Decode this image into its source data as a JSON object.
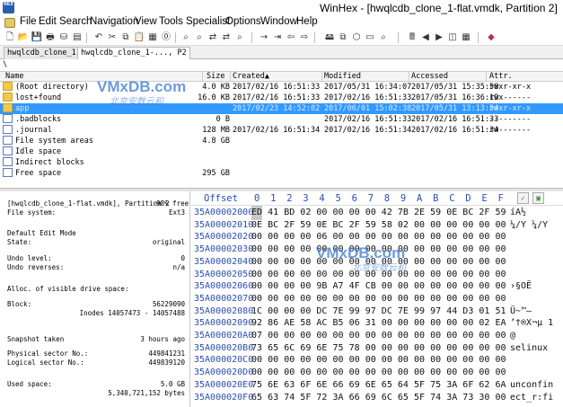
{
  "window": {
    "title": "WinHex - [hwqlcdb_clone_1-flat.vmdk, Partition 2]"
  },
  "menu": [
    "File",
    "Edit",
    "Search",
    "Navigation",
    "View",
    "Tools",
    "Specialist",
    "Options",
    "Window",
    "Help"
  ],
  "tabs": [
    {
      "label": "hwqlcdb_clone_1-...",
      "active": false
    },
    {
      "label": "hwqlcdb_clone_1-..., P2",
      "active": true
    }
  ],
  "path": "\\",
  "filelist": {
    "columns": [
      "Name",
      "Size",
      "Created▲",
      "Modified",
      "Accessed",
      "Attr."
    ],
    "rows": [
      {
        "name": "(Root directory)",
        "size": "4.0 KB",
        "created": "2017/02/16  16:51:33",
        "modified": "2017/05/31  16:34:07",
        "accessed": "2017/05/31  15:35:58",
        "attr": "rwxr-xr-x",
        "icon": "folder",
        "selected": false
      },
      {
        "name": "lost+found",
        "size": "16.0 KB",
        "created": "2017/02/16  16:51:33",
        "modified": "2017/02/16  16:51:33",
        "accessed": "2017/05/31  16:36:19",
        "attr": "rwx------",
        "icon": "folder",
        "selected": false
      },
      {
        "name": "app",
        "size": "",
        "created": "2017/02/23  14:52:02",
        "modified": "2017/06/01  15:02:38",
        "accessed": "2017/05/31  13:13:54",
        "attr": "rwxr-xr-x",
        "icon": "folder",
        "selected": true
      },
      {
        "name": ".badblocks",
        "size": "0 B",
        "created": "",
        "modified": "2017/02/16  16:51:33",
        "accessed": "2017/02/16  16:51:33",
        "attr": "---------",
        "icon": "file",
        "selected": false
      },
      {
        "name": ".journal",
        "size": "128 MB",
        "created": "2017/02/16  16:51:34",
        "modified": "2017/02/16  16:51:34",
        "accessed": "2017/02/16  16:51:34",
        "attr": "rw-------",
        "icon": "file",
        "selected": false
      },
      {
        "name": "File system areas",
        "size": "4.8 GB",
        "created": "",
        "modified": "",
        "accessed": "",
        "attr": "",
        "icon": "file",
        "selected": false
      },
      {
        "name": "Idle space",
        "size": "",
        "created": "",
        "modified": "",
        "accessed": "",
        "attr": "",
        "icon": "file",
        "selected": false
      },
      {
        "name": "Indirect blocks",
        "size": "",
        "created": "",
        "modified": "",
        "accessed": "",
        "attr": "",
        "icon": "file",
        "selected": false
      },
      {
        "name": "Free space",
        "size": "295 GB",
        "created": "",
        "modified": "",
        "accessed": "",
        "attr": "",
        "icon": "file",
        "selected": false
      }
    ]
  },
  "info": {
    "partition_label": "[hwqlcdb_clone_1-flat.vmdk], Partition 2",
    "free_pct": "98% free",
    "fs_label": "File system:",
    "fs_value": "Ext3",
    "edit_mode_label": "Default Edit Mode",
    "state_label": "State:",
    "state_value": "original",
    "undo_level_label": "Undo level:",
    "undo_level_value": "0",
    "undo_reverse_label": "Undo reverses:",
    "undo_reverse_value": "n/a",
    "alloc_label": "Alloc. of visible drive space:",
    "block_label": "Block:",
    "block_value": "56229090",
    "inodes_value": "Inodes 14057473 - 14057488",
    "snapshot_label": "Snapshot taken",
    "snapshot_value": "3 hours ago",
    "phys_label": "Physical sector No.:",
    "phys_value": "449841231",
    "logical_label": "Logical sector No.:",
    "logical_value": "449839120",
    "used_label": "Used space:",
    "used_value": "5.0 GB",
    "used_bytes": "5,340,721,152 bytes"
  },
  "hex": {
    "offset_header": "Offset",
    "col_headers": [
      "0",
      "1",
      "2",
      "3",
      "4",
      "5",
      "6",
      "7",
      "8",
      "9",
      "A",
      "B",
      "C",
      "D",
      "E",
      "F"
    ],
    "rows": [
      {
        "off": "35A00002000",
        "bytes": [
          "ED",
          "41",
          "BD",
          "02",
          "00",
          "00",
          "00",
          "00",
          "42",
          "7B",
          "2E",
          "59",
          "0E",
          "BC",
          "2F",
          "59"
        ],
        "text": "íA½"
      },
      {
        "off": "35A00002010",
        "bytes": [
          "0E",
          "BC",
          "2F",
          "59",
          "0E",
          "BC",
          "2F",
          "59",
          "58",
          "02",
          "00",
          "00",
          "00",
          "00",
          "00",
          "00"
        ],
        "text": " ¼/Y ¼/Y"
      },
      {
        "off": "35A00002020",
        "bytes": [
          "00",
          "00",
          "00",
          "00",
          "06",
          "00",
          "00",
          "00",
          "00",
          "00",
          "00",
          "00",
          "00",
          "00",
          "00",
          "00"
        ],
        "text": ""
      },
      {
        "off": "35A00002030",
        "bytes": [
          "00",
          "00",
          "00",
          "00",
          "00",
          "00",
          "00",
          "00",
          "00",
          "00",
          "00",
          "00",
          "00",
          "00",
          "00",
          "00"
        ],
        "text": ""
      },
      {
        "off": "35A00002040",
        "bytes": [
          "00",
          "00",
          "00",
          "00",
          "00",
          "00",
          "00",
          "00",
          "00",
          "00",
          "00",
          "00",
          "00",
          "00",
          "00",
          "00"
        ],
        "text": ""
      },
      {
        "off": "35A00002050",
        "bytes": [
          "00",
          "00",
          "00",
          "00",
          "00",
          "00",
          "00",
          "00",
          "00",
          "00",
          "00",
          "00",
          "00",
          "00",
          "00",
          "00"
        ],
        "text": ""
      },
      {
        "off": "35A00002060",
        "bytes": [
          "00",
          "00",
          "00",
          "00",
          "9B",
          "A7",
          "4F",
          "CB",
          "00",
          "00",
          "00",
          "00",
          "00",
          "00",
          "00",
          "00"
        ],
        "text": "    ›§OË"
      },
      {
        "off": "35A00002070",
        "bytes": [
          "00",
          "00",
          "00",
          "00",
          "00",
          "00",
          "00",
          "00",
          "00",
          "00",
          "00",
          "00",
          "00",
          "00",
          "00",
          "00"
        ],
        "text": ""
      },
      {
        "off": "35A00002080",
        "bytes": [
          "1C",
          "00",
          "00",
          "00",
          "DC",
          "7E",
          "99",
          "97",
          "DC",
          "7E",
          "99",
          "97",
          "44",
          "D3",
          "01",
          "51"
        ],
        "text": "    Ü~™—"
      },
      {
        "off": "35A00002090",
        "bytes": [
          "92",
          "86",
          "AE",
          "58",
          "AC",
          "B5",
          "06",
          "31",
          "00",
          "00",
          "00",
          "00",
          "00",
          "00",
          "02",
          "EA"
        ],
        "text": "’†®X¬µ 1"
      },
      {
        "off": "35A000020A0",
        "bytes": [
          "07",
          "00",
          "00",
          "00",
          "00",
          "00",
          "00",
          "00",
          "00",
          "00",
          "00",
          "00",
          "00",
          "00",
          "00",
          "00"
        ],
        "text": " @"
      },
      {
        "off": "35A000020B0",
        "bytes": [
          "73",
          "65",
          "6C",
          "69",
          "6E",
          "75",
          "78",
          "00",
          "00",
          "00",
          "00",
          "00",
          "00",
          "00",
          "00",
          "00"
        ],
        "text": "selinux"
      },
      {
        "off": "35A000020C0",
        "bytes": [
          "00",
          "00",
          "00",
          "00",
          "00",
          "00",
          "00",
          "00",
          "00",
          "00",
          "00",
          "00",
          "00",
          "00",
          "00",
          "00"
        ],
        "text": ""
      },
      {
        "off": "35A000020D0",
        "bytes": [
          "00",
          "00",
          "00",
          "00",
          "00",
          "00",
          "00",
          "00",
          "00",
          "00",
          "00",
          "00",
          "00",
          "00",
          "00",
          "00"
        ],
        "text": ""
      },
      {
        "off": "35A000020E0",
        "bytes": [
          "75",
          "6E",
          "63",
          "6F",
          "6E",
          "66",
          "69",
          "6E",
          "65",
          "64",
          "5F",
          "75",
          "3A",
          "6F",
          "62",
          "6A"
        ],
        "text": "unconfin"
      },
      {
        "off": "35A000020F0",
        "bytes": [
          "65",
          "63",
          "74",
          "5F",
          "72",
          "3A",
          "66",
          "69",
          "6C",
          "65",
          "5F",
          "74",
          "3A",
          "73",
          "30",
          "00"
        ],
        "text": "ect_r:fi"
      }
    ]
  },
  "watermark": {
    "brand": "VMxDB.com",
    "sub": "北京安数云和"
  },
  "colors": {
    "selection": "#3399ff",
    "offset_blue": "#2a4fb0"
  }
}
